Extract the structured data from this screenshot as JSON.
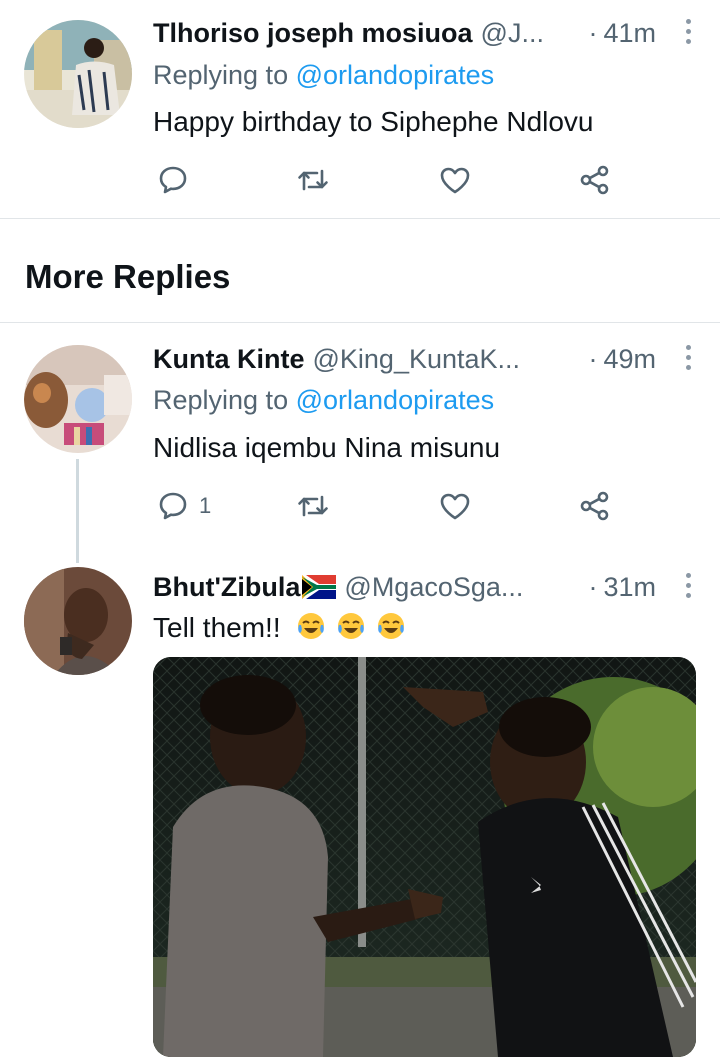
{
  "tweets": [
    {
      "name": "Tlhoriso joseph mosiuoa",
      "handle": "@J...",
      "dot": "·",
      "time": "41m",
      "replying_prefix": "Replying to",
      "replying_handle": "@orlandopirates",
      "text": "Happy birthday to Siphephe Ndlovu"
    },
    {
      "name": "Kunta Kinte",
      "handle": "@King_KuntaK...",
      "dot": "·",
      "time": "49m",
      "replying_prefix": "Replying to",
      "replying_handle": "@orlandopirates",
      "text": "Nidlisa iqembu Nina misunu",
      "reply_count": "1"
    },
    {
      "name": "Bhut'Zibula",
      "handle": "@MgacoSga...",
      "dot": "·",
      "time": "31m",
      "text": "Tell them!!"
    }
  ],
  "section": {
    "title": "More Replies"
  },
  "icons": {
    "reply": "reply-icon",
    "retweet": "retweet-icon",
    "like": "heart-icon",
    "share": "share-icon",
    "more": "more-vertical-icon",
    "flag": "south-africa-flag-icon",
    "emoji": "face-with-tears-of-joy-emoji"
  },
  "colors": {
    "link": "#1d9bf0",
    "secondary": "#536471",
    "text": "#0f1419",
    "divider": "#e1e5e8"
  }
}
